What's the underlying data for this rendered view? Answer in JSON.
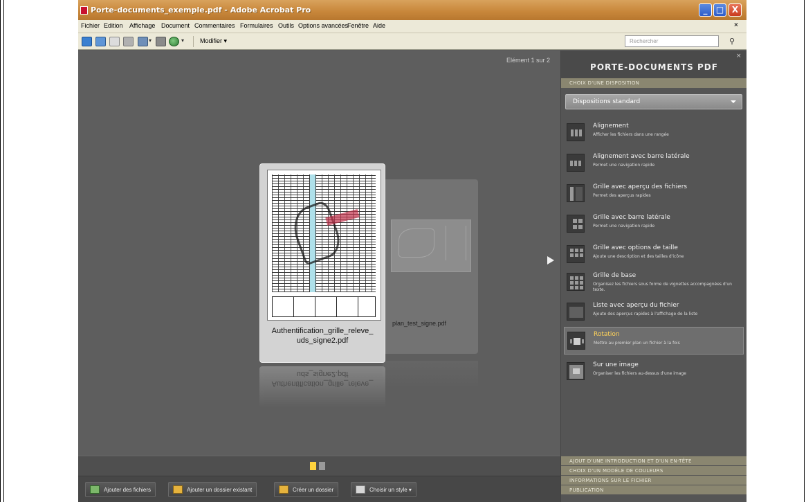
{
  "window": {
    "title": "Porte-documents_exemple.pdf - Adobe Acrobat Pro",
    "buttons": [
      "_",
      "□",
      "X"
    ]
  },
  "menubar": {
    "items": [
      "Fichier",
      "Edition",
      "Affichage",
      "Document",
      "Commentaires",
      "Formulaires",
      "Outils",
      "Options avancées",
      "Fenêtre",
      "Aide"
    ],
    "close": "×"
  },
  "toolbar": {
    "modifier_label": "Modifier ▾",
    "search_placeholder": "Rechercher"
  },
  "viewer": {
    "element_count": "Elément 1 sur 2",
    "files": [
      {
        "name": "Authentification_grille_releve_uds_signe2.pdf",
        "name_line1": "Authentification_grille_releve_",
        "name_line2": "uds_signe2.pdf"
      },
      {
        "name": "plan_test_signe.pdf"
      }
    ]
  },
  "bottom_bar": {
    "add_files": "Ajouter des fichiers",
    "add_existing_folder": "Ajouter un dossier existant",
    "create_folder": "Créer un dossier",
    "choose_style": "Choisir un style ▾"
  },
  "panel": {
    "title": "PORTE-DOCUMENTS PDF",
    "section_layout": "CHOIX D'UNE DISPOSITION",
    "dropdown": "Dispositions standard",
    "layouts": [
      {
        "title": "Alignement",
        "desc": "Afficher les fichiers dans une rangée"
      },
      {
        "title": "Alignement avec barre latérale",
        "desc": "Permet une navigation rapide"
      },
      {
        "title": "Grille avec aperçu des fichiers",
        "desc": "Permet des aperçus rapides"
      },
      {
        "title": "Grille avec barre latérale",
        "desc": "Permet une navigation rapide"
      },
      {
        "title": "Grille avec options de taille",
        "desc": "Ajoute une description et des tailles d'icône"
      },
      {
        "title": "Grille de base",
        "desc": "Organisez les fichiers sous forme de vignettes accompagnées d'un texte."
      },
      {
        "title": "Liste avec aperçu du fichier",
        "desc": "Ajoute des aperçus rapides à l'affichage de la liste"
      },
      {
        "title": "Rotation",
        "desc": "Mettre au premier plan un fichier à la fois"
      },
      {
        "title": "Sur une image",
        "desc": "Organiser les fichiers au-dessus d'une image"
      }
    ],
    "selected_layout": "Rotation",
    "sections_bottom": [
      "AJOUT D'UNE INTRODUCTION ET D'UN EN-TÊTE",
      "CHOIX D'UN MODÈLE DE COULEURS",
      "INFORMATIONS SUR LE FICHIER",
      "PUBLICATION"
    ]
  },
  "colors": {
    "titlebar": "#c9883c",
    "panel_section": "#8a8670",
    "accent_selected": "#ffd35a"
  }
}
